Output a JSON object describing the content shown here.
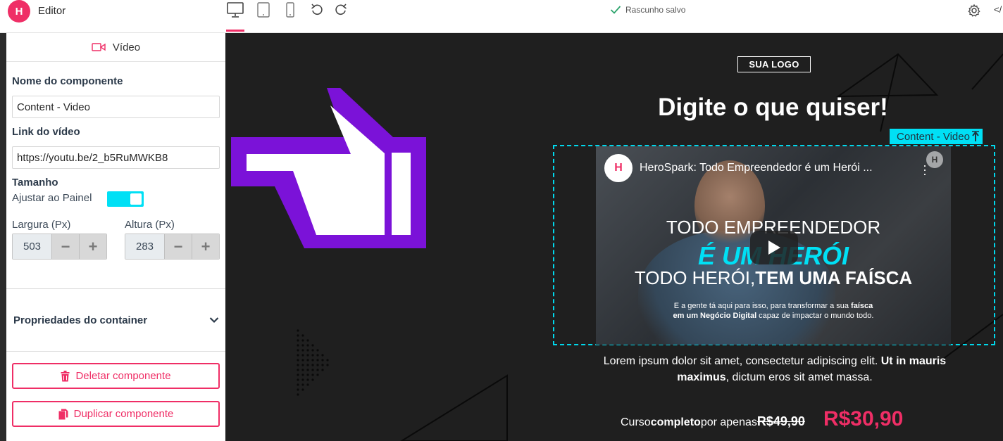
{
  "app": {
    "brand_mark": "H",
    "name": "Editor",
    "save_status": "Rascunho salvo",
    "code_toggle": "</"
  },
  "colors": {
    "accent": "#ef2e66",
    "highlight": "#00e0f5",
    "canvas_bg": "#1f1f1f",
    "pointer_purple": "#7b12d8"
  },
  "panel": {
    "header": "Vídeo",
    "component_name_label": "Nome do componente",
    "component_name_value": "Content - Video",
    "video_link_label": "Link do vídeo",
    "video_link_value": "https://youtu.be/2_b5RuMWKB8",
    "size_label": "Tamanho",
    "fit_label": "Ajustar ao Painel",
    "fit_enabled": true,
    "width_label": "Largura (Px)",
    "width_value": "503",
    "height_label": "Altura (Px)",
    "height_value": "283",
    "minus": "−",
    "plus": "+",
    "container_props_label": "Propriedades do container",
    "delete_label": "Deletar componente",
    "duplicate_label": "Duplicar componente"
  },
  "canvas": {
    "logo_text": "SUA LOGO",
    "headline": "Digite o que quiser!",
    "component_tag": "Content - Video",
    "video": {
      "channel_mark": "H",
      "title": "HeroSpark: Todo Empreendedor é um Herói ...",
      "line1": "TODO EMPREENDEDOR",
      "line2": "É UM HERÓI",
      "line3a": "TODO HERÓI,",
      "line3b": "TEM UMA FAÍSCA",
      "small1": "E a gente tá aqui para isso, para transformar a sua ",
      "small1b": "faísca",
      "small2a": "em um Negócio Digital",
      "small2b": " capaz de impactar o mundo todo."
    },
    "body_a": "Lorem ipsum dolor sit amet, consectetur adipiscing elit. ",
    "body_b": "Ut in mauris maximus",
    "body_c": ", dictum eros sit amet massa.",
    "price_a": "Curso ",
    "price_b": "completo",
    "price_c": " por apenas",
    "old_price": "R$49,90",
    "new_price": "R$30,90"
  }
}
